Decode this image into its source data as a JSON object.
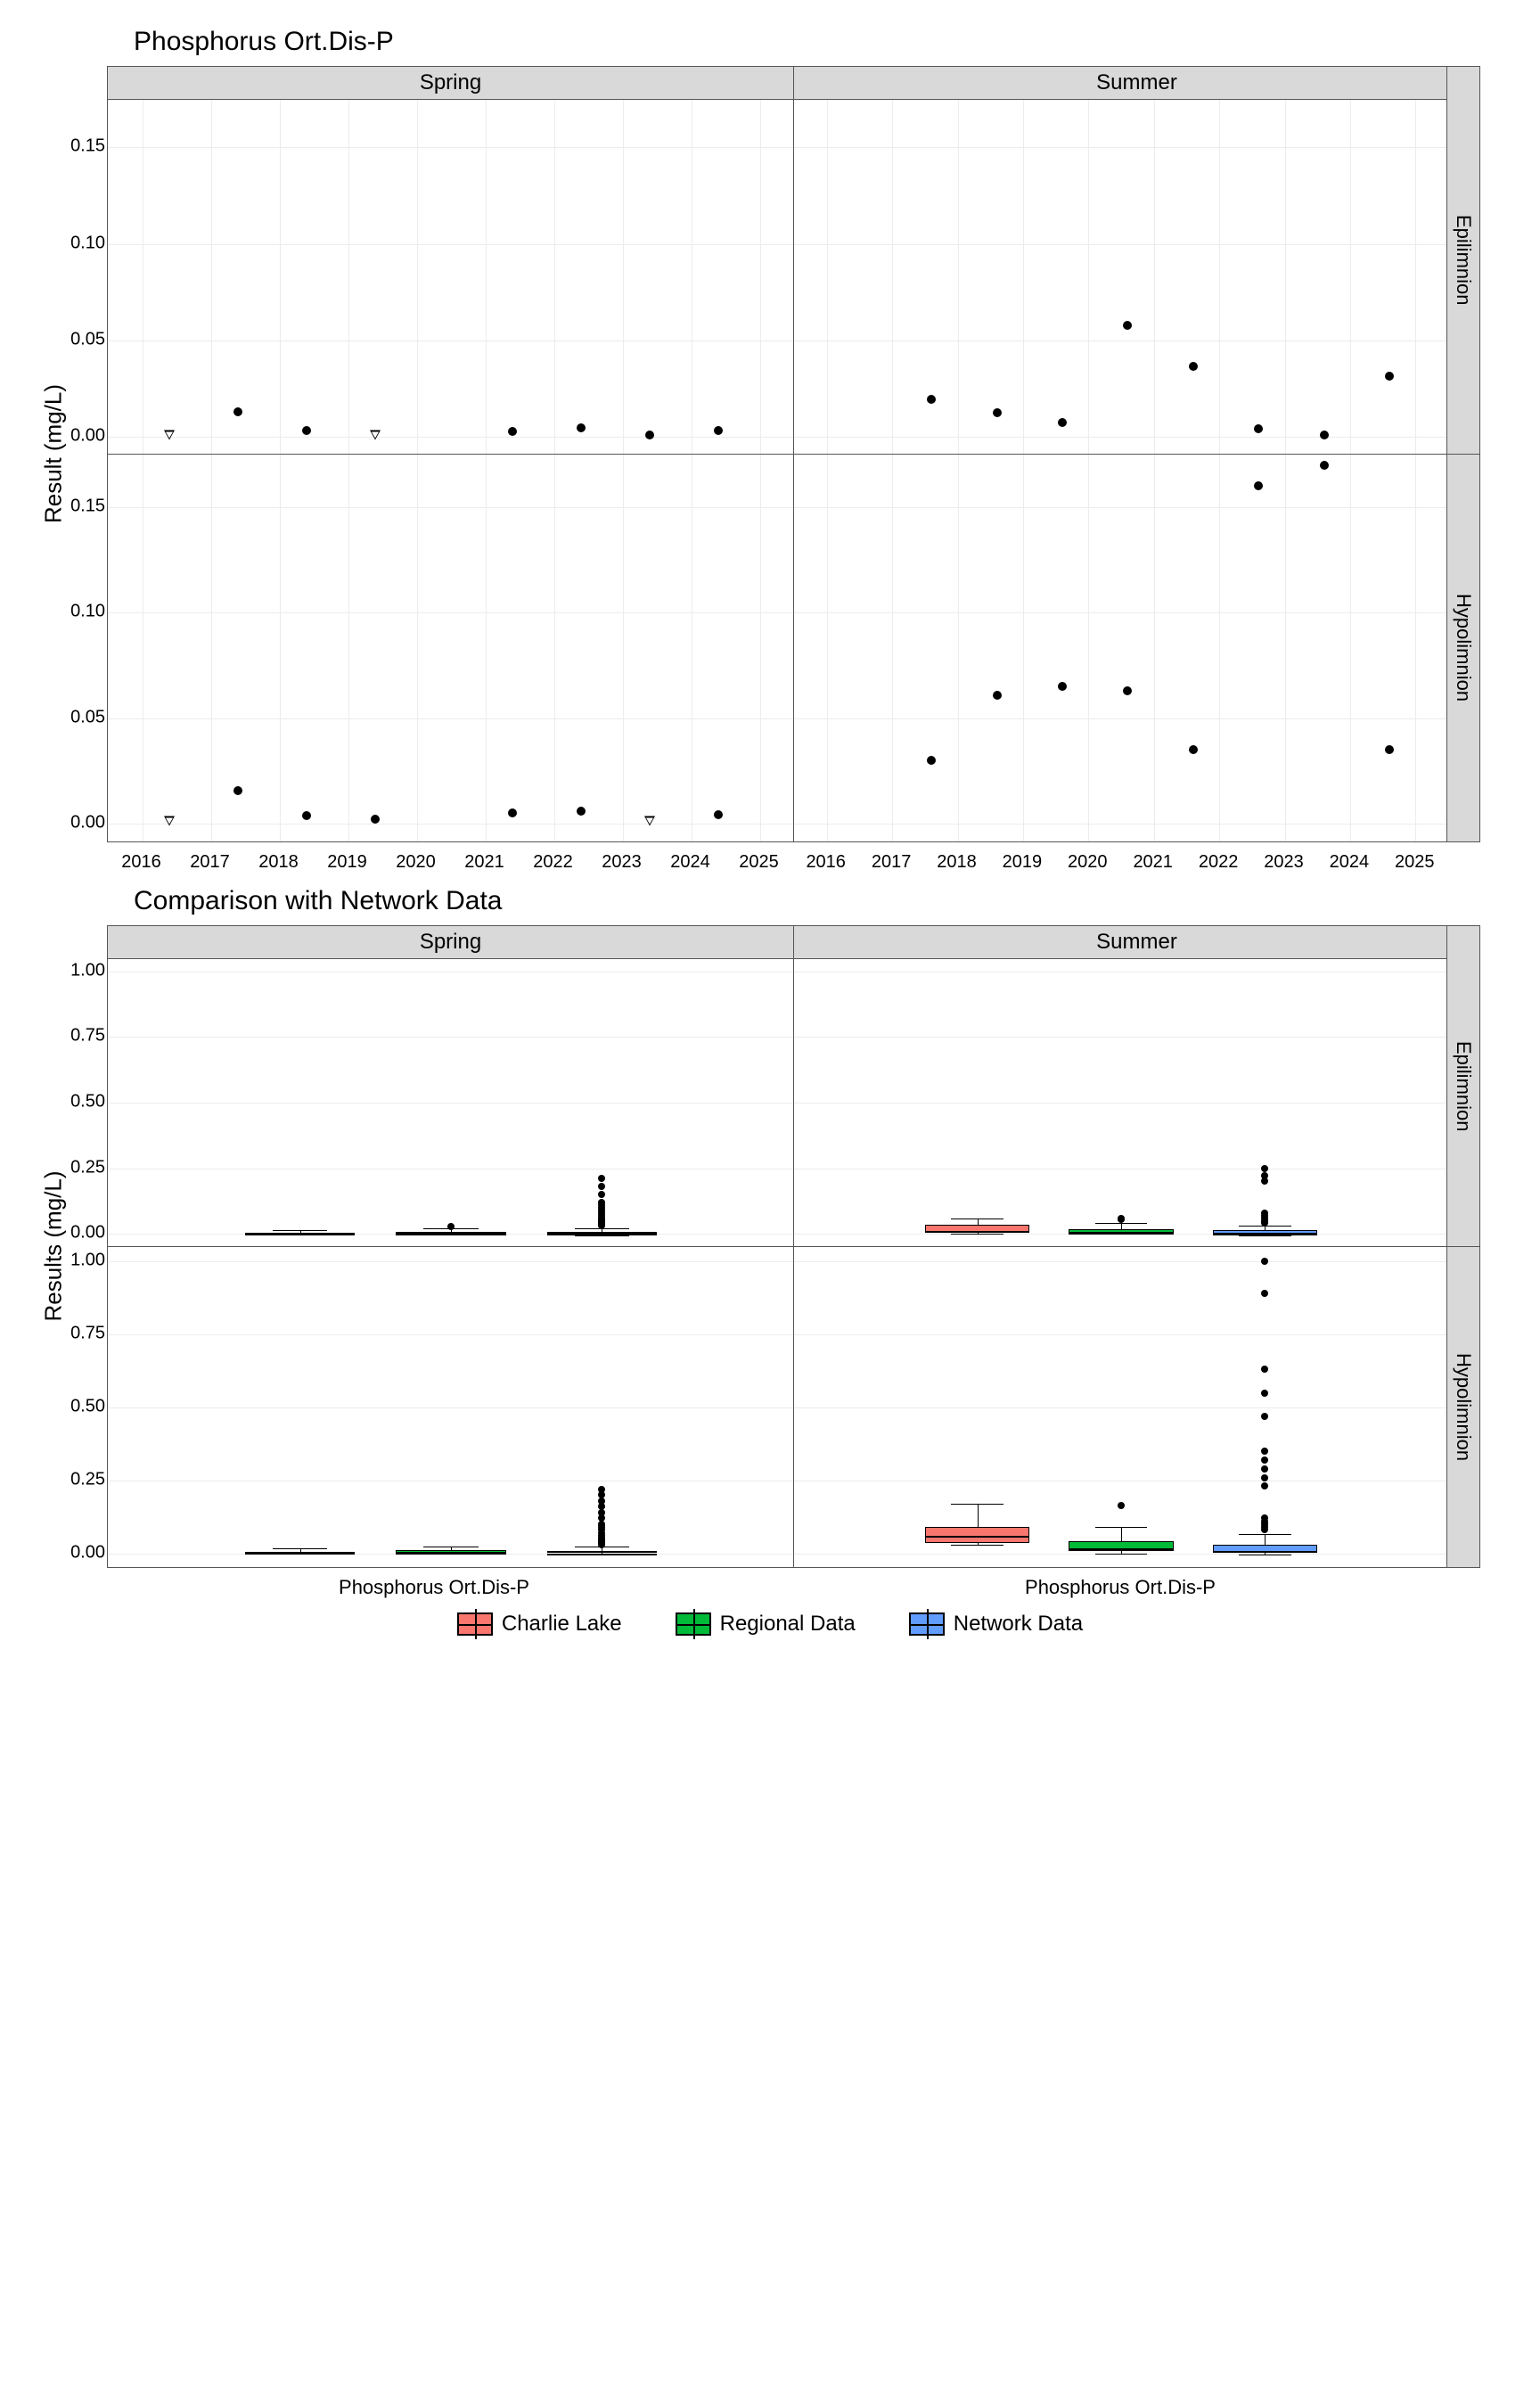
{
  "chart_data": [
    {
      "type": "scatter",
      "title": "Phosphorus Ort.Dis-P",
      "ylabel": "Result (mg/L)",
      "xlim": [
        2015.5,
        2025.5
      ],
      "ylim": [
        -0.009,
        0.175
      ],
      "xticks": [
        2016,
        2017,
        2018,
        2019,
        2020,
        2021,
        2022,
        2023,
        2024,
        2025
      ],
      "yticks": [
        0.0,
        0.05,
        0.1,
        0.15
      ],
      "facets_cols": [
        "Spring",
        "Summer"
      ],
      "facets_rows": [
        "Epilimnion",
        "Hypolimnion"
      ],
      "series": [
        {
          "row": "Epilimnion",
          "col": "Spring",
          "points": [
            {
              "x": 2016.4,
              "y": 0.001,
              "open": true
            },
            {
              "x": 2017.4,
              "y": 0.013
            },
            {
              "x": 2018.4,
              "y": 0.0035
            },
            {
              "x": 2019.4,
              "y": 0.001,
              "open": true
            },
            {
              "x": 2021.4,
              "y": 0.0028
            },
            {
              "x": 2022.4,
              "y": 0.0048
            },
            {
              "x": 2023.4,
              "y": 0.0012
            },
            {
              "x": 2024.4,
              "y": 0.0035
            }
          ]
        },
        {
          "row": "Epilimnion",
          "col": "Summer",
          "points": [
            {
              "x": 2017.6,
              "y": 0.0195
            },
            {
              "x": 2018.6,
              "y": 0.0125
            },
            {
              "x": 2019.6,
              "y": 0.0075
            },
            {
              "x": 2020.6,
              "y": 0.058
            },
            {
              "x": 2021.6,
              "y": 0.0365
            },
            {
              "x": 2022.6,
              "y": 0.0042
            },
            {
              "x": 2023.6,
              "y": 0.0012
            },
            {
              "x": 2024.6,
              "y": 0.0315
            }
          ]
        },
        {
          "row": "Hypolimnion",
          "col": "Spring",
          "points": [
            {
              "x": 2016.4,
              "y": 0.001,
              "open": true
            },
            {
              "x": 2017.4,
              "y": 0.0155
            },
            {
              "x": 2018.4,
              "y": 0.0038
            },
            {
              "x": 2019.4,
              "y": 0.0018
            },
            {
              "x": 2021.4,
              "y": 0.005
            },
            {
              "x": 2022.4,
              "y": 0.006
            },
            {
              "x": 2023.4,
              "y": 0.0012,
              "open": true
            },
            {
              "x": 2024.4,
              "y": 0.004
            }
          ]
        },
        {
          "row": "Hypolimnion",
          "col": "Summer",
          "points": [
            {
              "x": 2017.6,
              "y": 0.03
            },
            {
              "x": 2018.6,
              "y": 0.061
            },
            {
              "x": 2019.6,
              "y": 0.065
            },
            {
              "x": 2020.6,
              "y": 0.063
            },
            {
              "x": 2021.6,
              "y": 0.035
            },
            {
              "x": 2022.6,
              "y": 0.16
            },
            {
              "x": 2023.6,
              "y": 0.17
            },
            {
              "x": 2024.6,
              "y": 0.035
            }
          ]
        }
      ]
    },
    {
      "type": "box",
      "title": "Comparison with Network Data",
      "ylabel": "Results (mg/L)",
      "xlabel_center": "Phosphorus Ort.Dis-P",
      "ylim": [
        -0.05,
        1.05
      ],
      "yticks": [
        0.0,
        0.25,
        0.5,
        0.75,
        1.0
      ],
      "facets_cols": [
        "Spring",
        "Summer"
      ],
      "facets_rows": [
        "Epilimnion",
        "Hypolimnion"
      ],
      "legend": [
        {
          "name": "Charlie Lake",
          "color": "#f8766d"
        },
        {
          "name": "Regional Data",
          "color": "#00ba38"
        },
        {
          "name": "Network Data",
          "color": "#619cff"
        }
      ],
      "groups_x": [
        0.28,
        0.5,
        0.72
      ],
      "box_width": 0.16,
      "boxes": {
        "Spring|Epilimnion": [
          {
            "g": 0,
            "lo": 0.0,
            "q1": 0.002,
            "med": 0.003,
            "q3": 0.005,
            "hi": 0.013,
            "out": []
          },
          {
            "g": 1,
            "lo": 0.0,
            "q1": 0.002,
            "med": 0.004,
            "q3": 0.009,
            "hi": 0.02,
            "out": [
              0.028
            ]
          },
          {
            "g": 2,
            "lo": -0.005,
            "q1": 0.001,
            "med": 0.003,
            "q3": 0.008,
            "hi": 0.02,
            "out": [
              0.03,
              0.035,
              0.04,
              0.045,
              0.05,
              0.055,
              0.06,
              0.07,
              0.08,
              0.09,
              0.1,
              0.11,
              0.12,
              0.15,
              0.18,
              0.21
            ]
          }
        ],
        "Summer|Epilimnion": [
          {
            "g": 0,
            "lo": 0.001,
            "q1": 0.007,
            "med": 0.016,
            "q3": 0.034,
            "hi": 0.058,
            "out": []
          },
          {
            "g": 1,
            "lo": 0.0,
            "q1": 0.003,
            "med": 0.007,
            "q3": 0.018,
            "hi": 0.04,
            "out": [
              0.055,
              0.06
            ]
          },
          {
            "g": 2,
            "lo": -0.005,
            "q1": 0.002,
            "med": 0.005,
            "q3": 0.013,
            "hi": 0.03,
            "out": [
              0.04,
              0.045,
              0.05,
              0.06,
              0.07,
              0.08,
              0.2,
              0.22,
              0.25
            ]
          }
        ],
        "Spring|Hypolimnion": [
          {
            "g": 0,
            "lo": 0.001,
            "q1": 0.002,
            "med": 0.004,
            "q3": 0.006,
            "hi": 0.016,
            "out": []
          },
          {
            "g": 1,
            "lo": 0.0,
            "q1": 0.002,
            "med": 0.004,
            "q3": 0.01,
            "hi": 0.022,
            "out": []
          },
          {
            "g": 2,
            "lo": -0.005,
            "q1": 0.001,
            "med": 0.003,
            "q3": 0.009,
            "hi": 0.022,
            "out": [
              0.03,
              0.035,
              0.04,
              0.045,
              0.05,
              0.06,
              0.07,
              0.08,
              0.09,
              0.1,
              0.12,
              0.14,
              0.16,
              0.18,
              0.2,
              0.22
            ]
          }
        ],
        "Summer|Hypolimnion": [
          {
            "g": 0,
            "lo": 0.03,
            "q1": 0.035,
            "med": 0.062,
            "q3": 0.09,
            "hi": 0.17,
            "out": []
          },
          {
            "g": 1,
            "lo": 0.0,
            "q1": 0.008,
            "med": 0.02,
            "q3": 0.042,
            "hi": 0.09,
            "out": [
              0.165
            ]
          },
          {
            "g": 2,
            "lo": -0.005,
            "q1": 0.003,
            "med": 0.01,
            "q3": 0.028,
            "hi": 0.065,
            "out": [
              0.08,
              0.09,
              0.1,
              0.11,
              0.12,
              0.23,
              0.26,
              0.29,
              0.32,
              0.35,
              0.47,
              0.55,
              0.63,
              0.89,
              1.0
            ]
          }
        ]
      }
    }
  ],
  "titles": {
    "top": "Phosphorus Ort.Dis-P",
    "bottom": "Comparison with Network Data"
  },
  "ylabels": {
    "top": "Result (mg/L)",
    "bottom": "Results (mg/L)"
  },
  "cols": {
    "spring": "Spring",
    "summer": "Summer"
  },
  "rows": {
    "epi": "Epilimnion",
    "hypo": "Hypolimnion"
  },
  "legend": {
    "a": "Charlie Lake",
    "b": "Regional Data",
    "c": "Network Data"
  },
  "xbot": "Phosphorus Ort.Dis-P"
}
